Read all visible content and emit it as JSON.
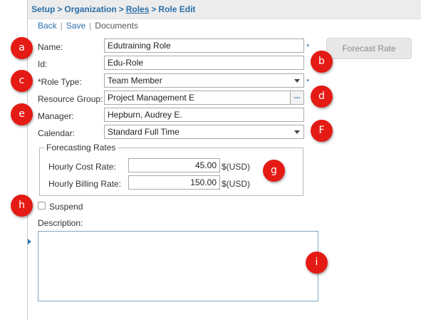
{
  "breadcrumb": {
    "setup": "Setup",
    "organization": "Organization",
    "roles": "Roles",
    "current": "Role Edit",
    "separator": ">"
  },
  "actions": {
    "back": "Back",
    "save": "Save",
    "documents": "Documents",
    "divider": "|"
  },
  "form": {
    "name": {
      "label": "Name:",
      "value": "Edutraining Role",
      "required_mark": "*"
    },
    "id": {
      "label": "Id:",
      "value": "Edu-Role"
    },
    "role_type": {
      "label": "*Role Type:",
      "value": "Team Member",
      "required_mark": "*"
    },
    "resource_group": {
      "label": "Resource Group:",
      "value": "Project Management E",
      "browse": "..."
    },
    "manager": {
      "label": "Manager:",
      "value": "Hepburn, Audrey E."
    },
    "calendar": {
      "label": "Calendar:",
      "value": "Standard Full Time"
    },
    "forecast_button": "Forecast Rate",
    "forecasting": {
      "legend": "Forecasting Rates",
      "cost": {
        "label": "Hourly Cost Rate:",
        "value": "45.00",
        "unit": "$(USD)"
      },
      "billing": {
        "label": "Hourly Billing Rate:",
        "value": "150.00",
        "unit": "$(USD)"
      }
    },
    "suspend": {
      "label": "Suspend",
      "checked": false
    },
    "description": {
      "label": "Description:",
      "value": ""
    }
  },
  "markers": {
    "a": "a",
    "b": "b",
    "c": "c",
    "d": "d",
    "e": "e",
    "f": "F",
    "g": "g",
    "h": "h",
    "i": "i",
    "color": "#e41b14"
  },
  "colors": {
    "link": "#2b6fa8",
    "topbar": "#ececec"
  }
}
